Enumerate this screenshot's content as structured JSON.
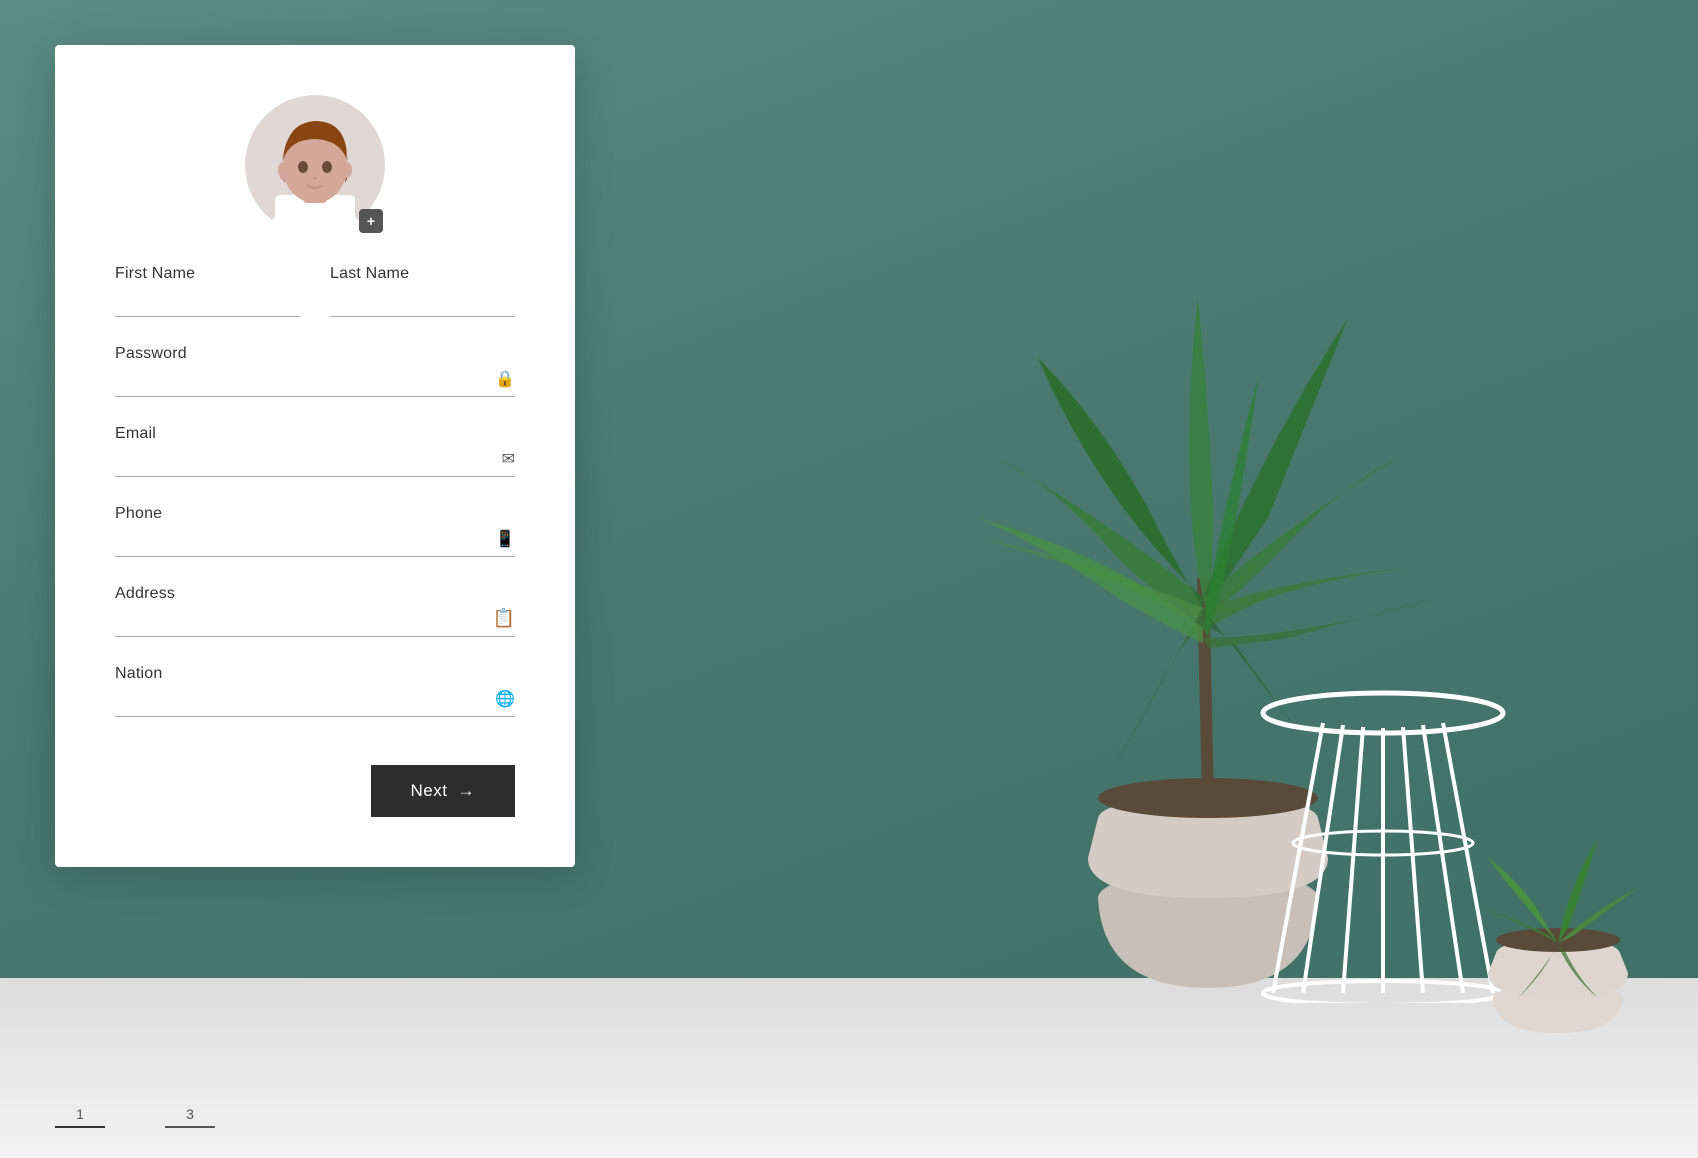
{
  "background": {
    "wall_color": "#4a7a70",
    "desk_color": "#e8e8e8"
  },
  "form": {
    "avatar": {
      "add_icon": "+"
    },
    "fields": {
      "first_name": {
        "label": "First Name",
        "placeholder": ""
      },
      "last_name": {
        "label": "Last Name",
        "placeholder": ""
      },
      "password": {
        "label": "Password",
        "placeholder": ""
      },
      "email": {
        "label": "Email",
        "placeholder": ""
      },
      "phone": {
        "label": "Phone",
        "placeholder": ""
      },
      "address": {
        "label": "Address",
        "placeholder": ""
      },
      "nation": {
        "label": "Nation",
        "placeholder": ""
      }
    },
    "next_button": {
      "label": "Next",
      "arrow": "→"
    }
  },
  "pagination": {
    "current": "1",
    "total": "3"
  },
  "icons": {
    "lock": "🔒",
    "email": "✉",
    "phone": "📱",
    "address": "📋",
    "nation": "🌐",
    "add_photo": "+"
  }
}
